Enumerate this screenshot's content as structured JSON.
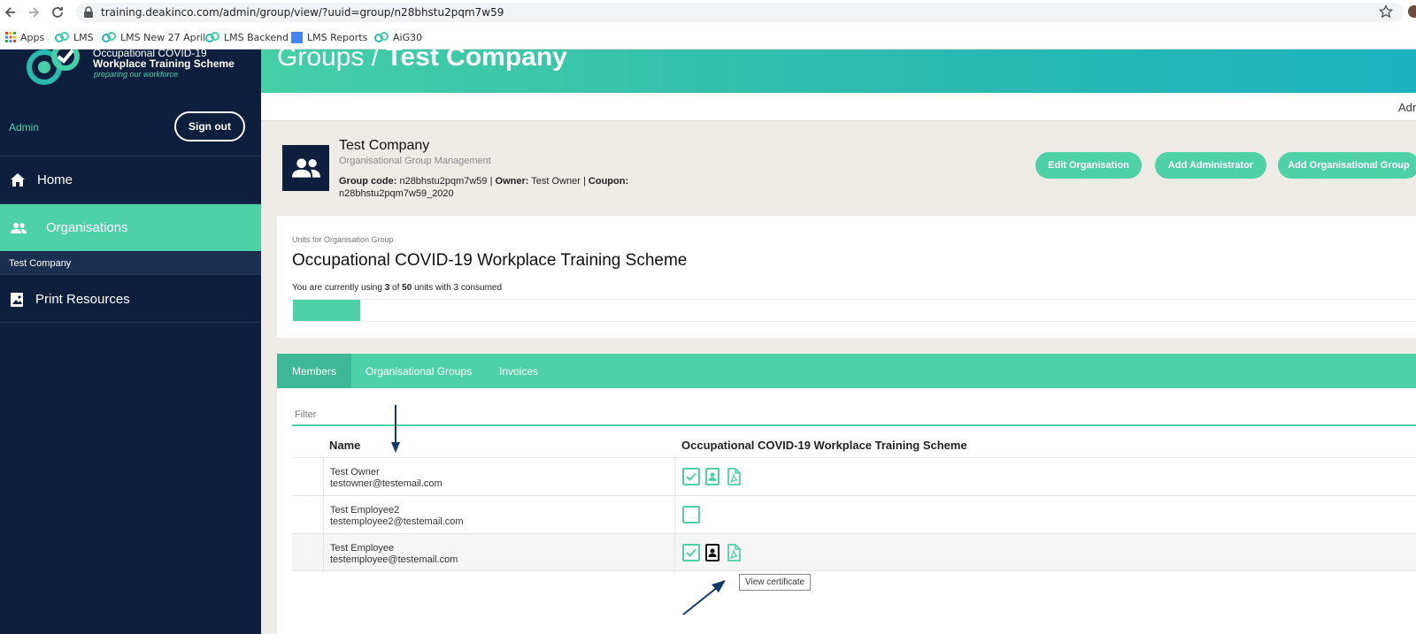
{
  "browser": {
    "url": "training.deakinco.com/admin/group/view/?uuid=group/n28bhstu2pqm7w59",
    "bookmarks": [
      {
        "label": "Apps"
      },
      {
        "label": "LMS"
      },
      {
        "label": "LMS New 27 April"
      },
      {
        "label": "LMS Backend"
      },
      {
        "label": "LMS Reports"
      },
      {
        "label": "AiG30"
      }
    ]
  },
  "sidebar": {
    "logo": {
      "line1": "Occupational COVID-19",
      "line2": "Workplace Training Scheme",
      "tagline": "preparing our workforce"
    },
    "role": "Admin",
    "signout_label": "Sign out",
    "nav": {
      "home": "Home",
      "organisations": "Organisations",
      "sub_item": "Test Company",
      "print_resources": "Print Resources"
    }
  },
  "header": {
    "breadcrumb_parent": "Groups / ",
    "breadcrumb_current": "Test Company",
    "top_strip_text": "Adm"
  },
  "org": {
    "name": "Test Company",
    "subtitle": "Organisational Group Management",
    "group_code_label": "Group code:",
    "group_code": "n28bhstu2pqm7w59",
    "owner_label": "Owner:",
    "owner": "Test Owner",
    "coupon_label": "Coupon:",
    "coupon": "n28bhstu2pqm7w59_2020",
    "sep": " | ",
    "buttons": {
      "edit": "Edit Organisation",
      "add_admin": "Add Administrator",
      "add_group": "Add Organisational Group"
    }
  },
  "units": {
    "label": "Units for Organisation Group",
    "title": "Occupational COVID-19 Workplace Training Scheme",
    "usage_prefix": "You are currently using ",
    "used": "3",
    "usage_of": " of ",
    "total": "50",
    "usage_mid": " units with ",
    "consumed": "3",
    "usage_suffix": " consumed",
    "used_fraction": 0.06
  },
  "members": {
    "tabs": [
      "Members",
      "Organisational Groups",
      "Invoices"
    ],
    "filter_placeholder": "Filter",
    "columns": {
      "name": "Name",
      "unit": "Occupational COVID-19 Workplace Training Scheme"
    },
    "rows": [
      {
        "name": "Test Owner",
        "email": "testowner@testemail.com",
        "completed": true,
        "has_certificate": true
      },
      {
        "name": "Test Employee2",
        "email": "testemployee2@testemail.com",
        "completed": false,
        "has_certificate": false
      },
      {
        "name": "Test Employee",
        "email": "testemployee@testemail.com",
        "completed": true,
        "has_certificate": true
      }
    ],
    "tooltip": "View certificate"
  },
  "colors": {
    "accent": "#4fd1a8",
    "sidebar": "#0d1f3c",
    "annotation_arrow": "#123a66"
  }
}
